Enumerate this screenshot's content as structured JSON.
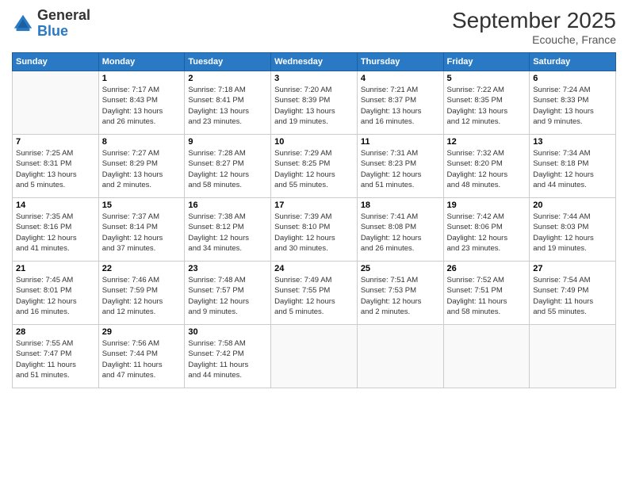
{
  "logo": {
    "general": "General",
    "blue": "Blue"
  },
  "title": "September 2025",
  "location": "Ecouche, France",
  "headers": [
    "Sunday",
    "Monday",
    "Tuesday",
    "Wednesday",
    "Thursday",
    "Friday",
    "Saturday"
  ],
  "weeks": [
    [
      {
        "day": "",
        "info": ""
      },
      {
        "day": "1",
        "info": "Sunrise: 7:17 AM\nSunset: 8:43 PM\nDaylight: 13 hours\nand 26 minutes."
      },
      {
        "day": "2",
        "info": "Sunrise: 7:18 AM\nSunset: 8:41 PM\nDaylight: 13 hours\nand 23 minutes."
      },
      {
        "day": "3",
        "info": "Sunrise: 7:20 AM\nSunset: 8:39 PM\nDaylight: 13 hours\nand 19 minutes."
      },
      {
        "day": "4",
        "info": "Sunrise: 7:21 AM\nSunset: 8:37 PM\nDaylight: 13 hours\nand 16 minutes."
      },
      {
        "day": "5",
        "info": "Sunrise: 7:22 AM\nSunset: 8:35 PM\nDaylight: 13 hours\nand 12 minutes."
      },
      {
        "day": "6",
        "info": "Sunrise: 7:24 AM\nSunset: 8:33 PM\nDaylight: 13 hours\nand 9 minutes."
      }
    ],
    [
      {
        "day": "7",
        "info": "Sunrise: 7:25 AM\nSunset: 8:31 PM\nDaylight: 13 hours\nand 5 minutes."
      },
      {
        "day": "8",
        "info": "Sunrise: 7:27 AM\nSunset: 8:29 PM\nDaylight: 13 hours\nand 2 minutes."
      },
      {
        "day": "9",
        "info": "Sunrise: 7:28 AM\nSunset: 8:27 PM\nDaylight: 12 hours\nand 58 minutes."
      },
      {
        "day": "10",
        "info": "Sunrise: 7:29 AM\nSunset: 8:25 PM\nDaylight: 12 hours\nand 55 minutes."
      },
      {
        "day": "11",
        "info": "Sunrise: 7:31 AM\nSunset: 8:23 PM\nDaylight: 12 hours\nand 51 minutes."
      },
      {
        "day": "12",
        "info": "Sunrise: 7:32 AM\nSunset: 8:20 PM\nDaylight: 12 hours\nand 48 minutes."
      },
      {
        "day": "13",
        "info": "Sunrise: 7:34 AM\nSunset: 8:18 PM\nDaylight: 12 hours\nand 44 minutes."
      }
    ],
    [
      {
        "day": "14",
        "info": "Sunrise: 7:35 AM\nSunset: 8:16 PM\nDaylight: 12 hours\nand 41 minutes."
      },
      {
        "day": "15",
        "info": "Sunrise: 7:37 AM\nSunset: 8:14 PM\nDaylight: 12 hours\nand 37 minutes."
      },
      {
        "day": "16",
        "info": "Sunrise: 7:38 AM\nSunset: 8:12 PM\nDaylight: 12 hours\nand 34 minutes."
      },
      {
        "day": "17",
        "info": "Sunrise: 7:39 AM\nSunset: 8:10 PM\nDaylight: 12 hours\nand 30 minutes."
      },
      {
        "day": "18",
        "info": "Sunrise: 7:41 AM\nSunset: 8:08 PM\nDaylight: 12 hours\nand 26 minutes."
      },
      {
        "day": "19",
        "info": "Sunrise: 7:42 AM\nSunset: 8:06 PM\nDaylight: 12 hours\nand 23 minutes."
      },
      {
        "day": "20",
        "info": "Sunrise: 7:44 AM\nSunset: 8:03 PM\nDaylight: 12 hours\nand 19 minutes."
      }
    ],
    [
      {
        "day": "21",
        "info": "Sunrise: 7:45 AM\nSunset: 8:01 PM\nDaylight: 12 hours\nand 16 minutes."
      },
      {
        "day": "22",
        "info": "Sunrise: 7:46 AM\nSunset: 7:59 PM\nDaylight: 12 hours\nand 12 minutes."
      },
      {
        "day": "23",
        "info": "Sunrise: 7:48 AM\nSunset: 7:57 PM\nDaylight: 12 hours\nand 9 minutes."
      },
      {
        "day": "24",
        "info": "Sunrise: 7:49 AM\nSunset: 7:55 PM\nDaylight: 12 hours\nand 5 minutes."
      },
      {
        "day": "25",
        "info": "Sunrise: 7:51 AM\nSunset: 7:53 PM\nDaylight: 12 hours\nand 2 minutes."
      },
      {
        "day": "26",
        "info": "Sunrise: 7:52 AM\nSunset: 7:51 PM\nDaylight: 11 hours\nand 58 minutes."
      },
      {
        "day": "27",
        "info": "Sunrise: 7:54 AM\nSunset: 7:49 PM\nDaylight: 11 hours\nand 55 minutes."
      }
    ],
    [
      {
        "day": "28",
        "info": "Sunrise: 7:55 AM\nSunset: 7:47 PM\nDaylight: 11 hours\nand 51 minutes."
      },
      {
        "day": "29",
        "info": "Sunrise: 7:56 AM\nSunset: 7:44 PM\nDaylight: 11 hours\nand 47 minutes."
      },
      {
        "day": "30",
        "info": "Sunrise: 7:58 AM\nSunset: 7:42 PM\nDaylight: 11 hours\nand 44 minutes."
      },
      {
        "day": "",
        "info": ""
      },
      {
        "day": "",
        "info": ""
      },
      {
        "day": "",
        "info": ""
      },
      {
        "day": "",
        "info": ""
      }
    ]
  ]
}
